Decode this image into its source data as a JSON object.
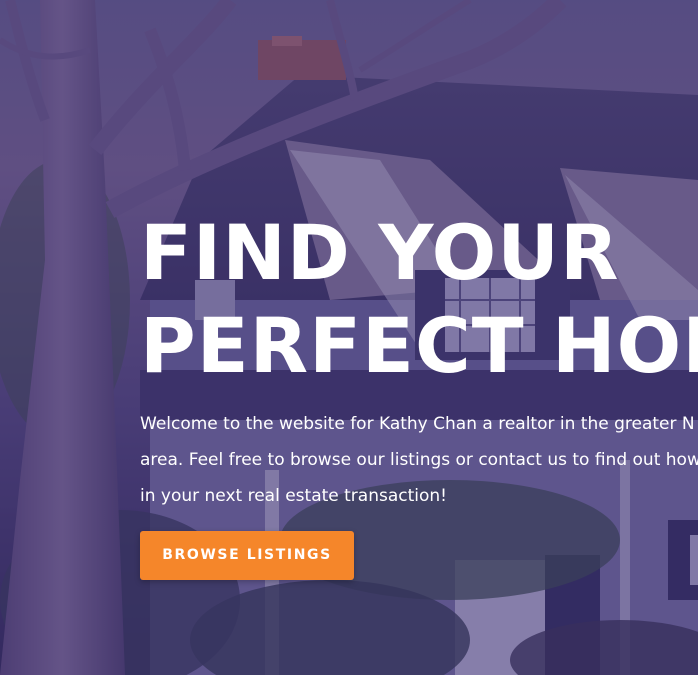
{
  "hero": {
    "title_line1": "FIND YOUR",
    "title_line2": "PERFECT HOME",
    "intro_line1": "Welcome to the website for Kathy Chan a realtor in the greater N",
    "intro_line2": "area. Feel free to browse our listings or contact us to find out how",
    "intro_line3": "in your next real estate transaction!",
    "button_label": "BROWSE LISTINGS"
  },
  "colors": {
    "overlay": "#3b2f6e",
    "button": "#f5862a",
    "text": "#ffffff"
  }
}
